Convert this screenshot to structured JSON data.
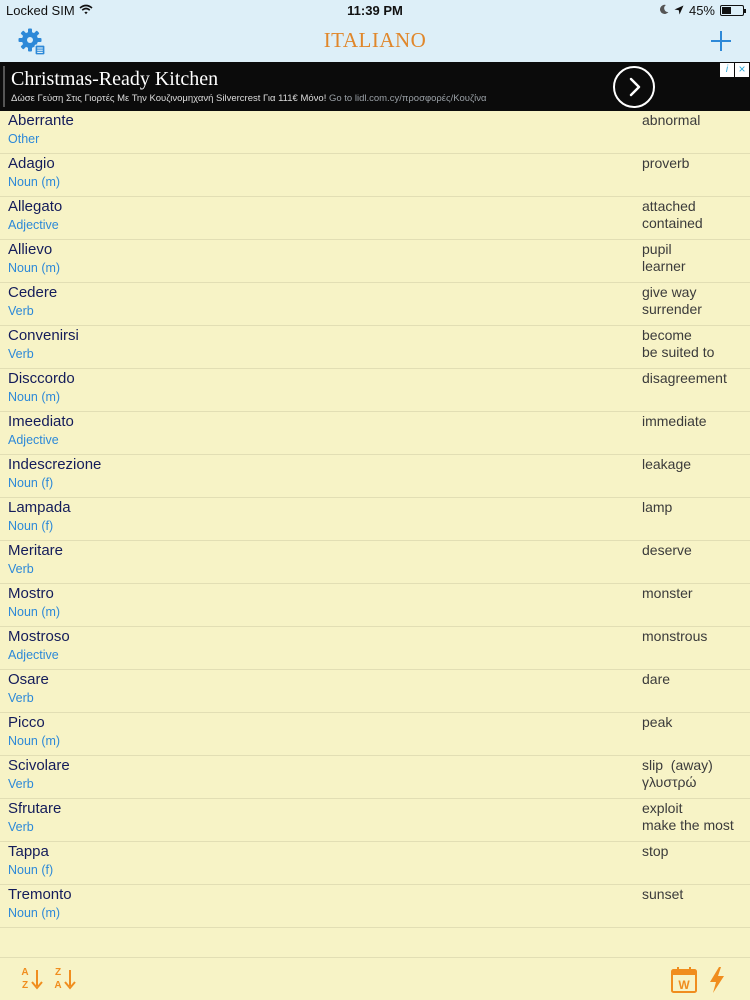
{
  "colors": {
    "nav_bar_bg": "#ddeff8",
    "accent_blue": "#2d89d8",
    "title_orange": "#e0872b",
    "list_bg": "#f7f3c6",
    "word_text": "#141c5a",
    "translation_text": "#3b3b3b",
    "bottom_icon_orange": "#f08d1e"
  },
  "status_bar": {
    "carrier": "Locked SIM",
    "time": "11:39 PM",
    "battery": "45%",
    "battery_level": 0.45,
    "icons": [
      "wifi-icon",
      "moon-icon",
      "location-icon",
      "battery-icon"
    ]
  },
  "nav_bar": {
    "title": "ITALIANO",
    "left_icon": "gear-icon",
    "right_icon": "plus-icon"
  },
  "ad": {
    "title": "Christmas-Ready Kitchen",
    "subtitle": "Δώσε Γεύση Στις Γιορτές Με Την Κουζινομηχανή Silvercrest Για 111€ Μόνο!",
    "link_text": "Go to lidl.com.cy/προσφορές/Κουζίνα",
    "arrow_icon": "chevron-right-icon",
    "info_icon": "info-icon",
    "close_icon": "close-icon",
    "info_label": "i",
    "close_label": "×"
  },
  "words": [
    {
      "italian": "Aberrante",
      "type": "Other",
      "english": "abnormal"
    },
    {
      "italian": "Adagio",
      "type": "Noun (m)",
      "english": "proverb"
    },
    {
      "italian": "Allegato",
      "type": "Adjective",
      "english": "attached\ncontained"
    },
    {
      "italian": "Allievo",
      "type": "Noun (m)",
      "english": "pupil\nlearner"
    },
    {
      "italian": "Cedere",
      "type": "Verb",
      "english": "give way\nsurrender"
    },
    {
      "italian": "Convenirsi",
      "type": "Verb",
      "english": "become\nbe suited to"
    },
    {
      "italian": "Disccordo",
      "type": "Noun (m)",
      "english": "disagreement"
    },
    {
      "italian": "Imeediato",
      "type": "Adjective",
      "english": "immediate"
    },
    {
      "italian": "Indescrezione",
      "type": "Noun (f)",
      "english": "leakage"
    },
    {
      "italian": "Lampada",
      "type": "Noun (f)",
      "english": "lamp"
    },
    {
      "italian": "Meritare",
      "type": "Verb",
      "english": "deserve"
    },
    {
      "italian": "Mostro",
      "type": "Noun (m)",
      "english": "monster"
    },
    {
      "italian": "Mostroso",
      "type": "Adjective",
      "english": "monstrous"
    },
    {
      "italian": "Osare",
      "type": "Verb",
      "english": "dare"
    },
    {
      "italian": "Picco",
      "type": "Noun (m)",
      "english": "peak"
    },
    {
      "italian": "Scivolare",
      "type": "Verb",
      "english": "slip  (away)\nγλυστρώ"
    },
    {
      "italian": "Sfrutare",
      "type": "Verb",
      "english": "exploit\nmake the most"
    },
    {
      "italian": "Tappa",
      "type": "Noun (f)",
      "english": "stop"
    },
    {
      "italian": "Tremonto",
      "type": "Noun (m)",
      "english": "sunset"
    }
  ],
  "bottom_bar": {
    "sort_az": {
      "top": "A",
      "bottom": "Z",
      "icon": "sort-az-icon"
    },
    "sort_za": {
      "top": "Z",
      "bottom": "A",
      "icon": "sort-za-icon"
    },
    "calendar_letter": "W",
    "calendar_icon": "calendar-icon",
    "bolt_icon": "lightning-icon"
  }
}
